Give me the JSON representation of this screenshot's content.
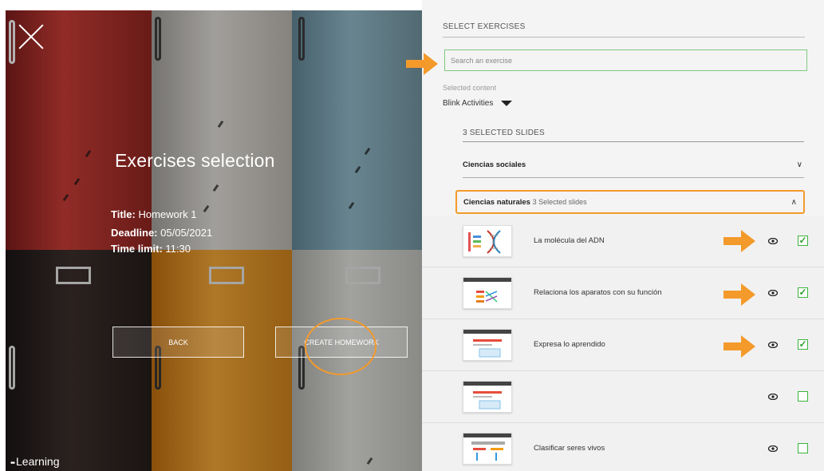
{
  "left": {
    "title": "Exercises selection",
    "info": [
      {
        "label": "Title:",
        "value": "Homework 1"
      },
      {
        "label": "Deadline:",
        "value": "05/05/2021"
      },
      {
        "label": "Time limit:",
        "value": "11:30"
      }
    ],
    "back_label": "BACK",
    "create_label": "CREATE HOMEWORK",
    "brand": "Learning",
    "brand_dots": "••"
  },
  "right": {
    "select_title": "SELECT EXERCISES",
    "search_placeholder": "Search an exercise",
    "selected_content_label": "Selected content",
    "content_source": "Blink Activities",
    "slides_count": "3 SELECTED SLIDES",
    "accordions": [
      {
        "title": "Ciencias sociales",
        "sub": "",
        "state_icon": "chevron-down-icon",
        "chevron": "∨"
      },
      {
        "title": "Ciencias naturales",
        "sub": "3 Selected slides",
        "state_icon": "chevron-up-icon",
        "chevron": "∧"
      }
    ],
    "exercises": [
      {
        "title": "La molécula del ADN",
        "checked": true,
        "check_glyph": "✓"
      },
      {
        "title": "Relaciona los aparatos con su función",
        "checked": true,
        "check_glyph": "✓"
      },
      {
        "title": "Expresa lo aprendido",
        "checked": true,
        "check_glyph": "✓"
      },
      {
        "title": "",
        "checked": false,
        "check_glyph": ""
      },
      {
        "title": "Clasificar seres vivos",
        "checked": false,
        "check_glyph": ""
      }
    ]
  },
  "colors": {
    "accent_orange": "#f39a2b",
    "check_green": "#3cb43c",
    "search_border": "#7fc97f"
  }
}
